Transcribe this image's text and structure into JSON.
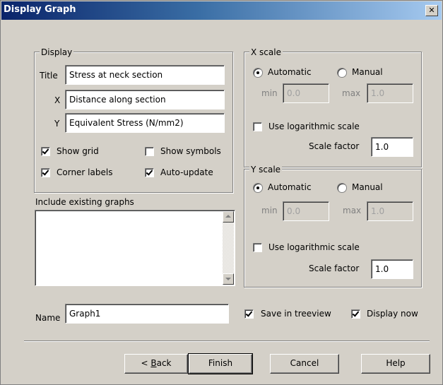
{
  "window": {
    "title": "Display Graph",
    "close_glyph": "✕"
  },
  "display": {
    "group_label": "Display",
    "title_label": "Title",
    "title_value": "Stress at neck section",
    "x_label": "X",
    "x_value": "Distance along section",
    "y_label": "Y",
    "y_value": "Equivalent Stress (N/mm2)",
    "show_grid": {
      "label": "Show grid",
      "checked": true
    },
    "show_symbols": {
      "label": "Show symbols",
      "checked": false
    },
    "corner_labels": {
      "label": "Corner labels",
      "checked": true
    },
    "auto_update": {
      "label": "Auto-update",
      "checked": true
    }
  },
  "include": {
    "label": "Include existing graphs",
    "items": []
  },
  "x_scale": {
    "group_label": "X scale",
    "automatic": {
      "label": "Automatic",
      "selected": true
    },
    "manual": {
      "label": "Manual",
      "selected": false
    },
    "min_label": "min",
    "min_value": "0.0",
    "max_label": "max",
    "max_value": "1.0",
    "log": {
      "label": "Use logarithmic scale",
      "checked": false
    },
    "scale_factor_label": "Scale factor",
    "scale_factor_value": "1.0"
  },
  "y_scale": {
    "group_label": "Y scale",
    "automatic": {
      "label": "Automatic",
      "selected": true
    },
    "manual": {
      "label": "Manual",
      "selected": false
    },
    "min_label": "min",
    "min_value": "0.0",
    "max_label": "max",
    "max_value": "1.0",
    "log": {
      "label": "Use logarithmic scale",
      "checked": false
    },
    "scale_factor_label": "Scale factor",
    "scale_factor_value": "1.0"
  },
  "name": {
    "label": "Name",
    "value": "Graph1"
  },
  "save_in_treeview": {
    "label": "Save in treeview",
    "checked": true
  },
  "display_now": {
    "label": "Display now",
    "checked": true
  },
  "buttons": {
    "back_prefix": "< ",
    "back_mnemonic": "B",
    "back_rest": "ack",
    "finish": "Finish",
    "cancel": "Cancel",
    "help": "Help"
  }
}
